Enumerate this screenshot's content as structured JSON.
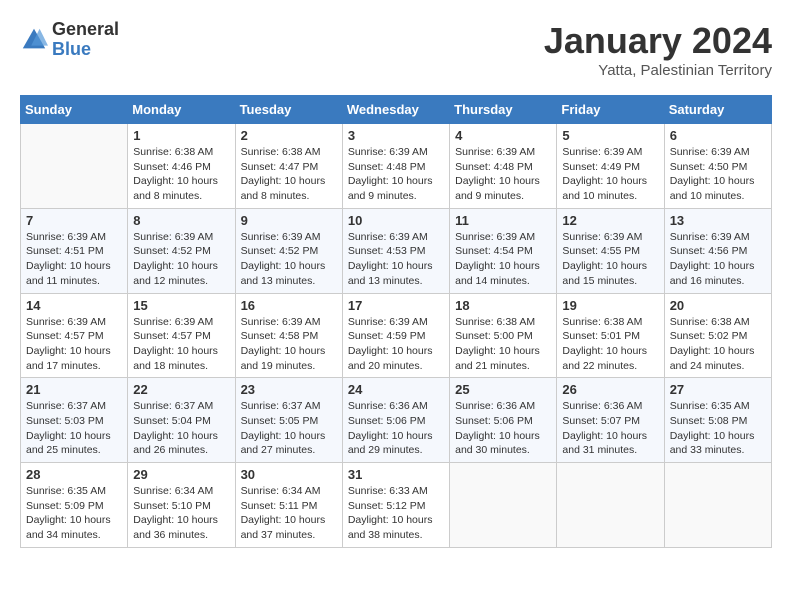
{
  "header": {
    "logo_general": "General",
    "logo_blue": "Blue",
    "main_title": "January 2024",
    "subtitle": "Yatta, Palestinian Territory"
  },
  "calendar": {
    "days_of_week": [
      "Sunday",
      "Monday",
      "Tuesday",
      "Wednesday",
      "Thursday",
      "Friday",
      "Saturday"
    ],
    "weeks": [
      [
        {
          "num": "",
          "info": ""
        },
        {
          "num": "1",
          "info": "Sunrise: 6:38 AM\nSunset: 4:46 PM\nDaylight: 10 hours\nand 8 minutes."
        },
        {
          "num": "2",
          "info": "Sunrise: 6:38 AM\nSunset: 4:47 PM\nDaylight: 10 hours\nand 8 minutes."
        },
        {
          "num": "3",
          "info": "Sunrise: 6:39 AM\nSunset: 4:48 PM\nDaylight: 10 hours\nand 9 minutes."
        },
        {
          "num": "4",
          "info": "Sunrise: 6:39 AM\nSunset: 4:48 PM\nDaylight: 10 hours\nand 9 minutes."
        },
        {
          "num": "5",
          "info": "Sunrise: 6:39 AM\nSunset: 4:49 PM\nDaylight: 10 hours\nand 10 minutes."
        },
        {
          "num": "6",
          "info": "Sunrise: 6:39 AM\nSunset: 4:50 PM\nDaylight: 10 hours\nand 10 minutes."
        }
      ],
      [
        {
          "num": "7",
          "info": "Sunrise: 6:39 AM\nSunset: 4:51 PM\nDaylight: 10 hours\nand 11 minutes."
        },
        {
          "num": "8",
          "info": "Sunrise: 6:39 AM\nSunset: 4:52 PM\nDaylight: 10 hours\nand 12 minutes."
        },
        {
          "num": "9",
          "info": "Sunrise: 6:39 AM\nSunset: 4:52 PM\nDaylight: 10 hours\nand 13 minutes."
        },
        {
          "num": "10",
          "info": "Sunrise: 6:39 AM\nSunset: 4:53 PM\nDaylight: 10 hours\nand 13 minutes."
        },
        {
          "num": "11",
          "info": "Sunrise: 6:39 AM\nSunset: 4:54 PM\nDaylight: 10 hours\nand 14 minutes."
        },
        {
          "num": "12",
          "info": "Sunrise: 6:39 AM\nSunset: 4:55 PM\nDaylight: 10 hours\nand 15 minutes."
        },
        {
          "num": "13",
          "info": "Sunrise: 6:39 AM\nSunset: 4:56 PM\nDaylight: 10 hours\nand 16 minutes."
        }
      ],
      [
        {
          "num": "14",
          "info": "Sunrise: 6:39 AM\nSunset: 4:57 PM\nDaylight: 10 hours\nand 17 minutes."
        },
        {
          "num": "15",
          "info": "Sunrise: 6:39 AM\nSunset: 4:57 PM\nDaylight: 10 hours\nand 18 minutes."
        },
        {
          "num": "16",
          "info": "Sunrise: 6:39 AM\nSunset: 4:58 PM\nDaylight: 10 hours\nand 19 minutes."
        },
        {
          "num": "17",
          "info": "Sunrise: 6:39 AM\nSunset: 4:59 PM\nDaylight: 10 hours\nand 20 minutes."
        },
        {
          "num": "18",
          "info": "Sunrise: 6:38 AM\nSunset: 5:00 PM\nDaylight: 10 hours\nand 21 minutes."
        },
        {
          "num": "19",
          "info": "Sunrise: 6:38 AM\nSunset: 5:01 PM\nDaylight: 10 hours\nand 22 minutes."
        },
        {
          "num": "20",
          "info": "Sunrise: 6:38 AM\nSunset: 5:02 PM\nDaylight: 10 hours\nand 24 minutes."
        }
      ],
      [
        {
          "num": "21",
          "info": "Sunrise: 6:37 AM\nSunset: 5:03 PM\nDaylight: 10 hours\nand 25 minutes."
        },
        {
          "num": "22",
          "info": "Sunrise: 6:37 AM\nSunset: 5:04 PM\nDaylight: 10 hours\nand 26 minutes."
        },
        {
          "num": "23",
          "info": "Sunrise: 6:37 AM\nSunset: 5:05 PM\nDaylight: 10 hours\nand 27 minutes."
        },
        {
          "num": "24",
          "info": "Sunrise: 6:36 AM\nSunset: 5:06 PM\nDaylight: 10 hours\nand 29 minutes."
        },
        {
          "num": "25",
          "info": "Sunrise: 6:36 AM\nSunset: 5:06 PM\nDaylight: 10 hours\nand 30 minutes."
        },
        {
          "num": "26",
          "info": "Sunrise: 6:36 AM\nSunset: 5:07 PM\nDaylight: 10 hours\nand 31 minutes."
        },
        {
          "num": "27",
          "info": "Sunrise: 6:35 AM\nSunset: 5:08 PM\nDaylight: 10 hours\nand 33 minutes."
        }
      ],
      [
        {
          "num": "28",
          "info": "Sunrise: 6:35 AM\nSunset: 5:09 PM\nDaylight: 10 hours\nand 34 minutes."
        },
        {
          "num": "29",
          "info": "Sunrise: 6:34 AM\nSunset: 5:10 PM\nDaylight: 10 hours\nand 36 minutes."
        },
        {
          "num": "30",
          "info": "Sunrise: 6:34 AM\nSunset: 5:11 PM\nDaylight: 10 hours\nand 37 minutes."
        },
        {
          "num": "31",
          "info": "Sunrise: 6:33 AM\nSunset: 5:12 PM\nDaylight: 10 hours\nand 38 minutes."
        },
        {
          "num": "",
          "info": ""
        },
        {
          "num": "",
          "info": ""
        },
        {
          "num": "",
          "info": ""
        }
      ]
    ]
  }
}
